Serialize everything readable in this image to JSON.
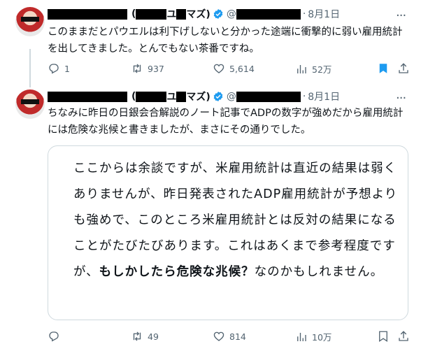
{
  "tweets": [
    {
      "name_fragment": "ユ",
      "name_open": "(",
      "name_close": "マズ)",
      "handle_prefix": "@",
      "date": "8月1日",
      "text": "このままだとパウエルは利下げしないと分かった途端に衝撃的に弱い雇用統計を出してきました。とんでもない茶番ですね。",
      "replies": "1",
      "retweets": "937",
      "likes": "5,614",
      "views": "52万"
    },
    {
      "name_fragment": "ユ",
      "name_open": "(",
      "name_close": "マズ)",
      "handle_prefix": "@",
      "date": "8月1日",
      "text": "ちなみに昨日の日銀会合解説のノート記事でADPの数字が強めだから雇用統計には危険な兆候と書きましたが、まさにその通りでした。",
      "quote": {
        "text_before": "ここからは余談ですが、米雇用統計は直近の結果は弱くありませんが、昨日発表されたADP雇用統計が予想よりも強めで、このところ米雇用統計とは反対の結果になることがたびたびあります。これはあくまで参考程度ですが、",
        "text_bold": "もしかしたら危険な兆候？",
        "text_after": "なのかもしれません。"
      },
      "replies": "",
      "retweets": "49",
      "likes": "814",
      "views": "10万"
    }
  ],
  "icons": {
    "more": "more-icon",
    "reply": "reply-icon",
    "retweet": "retweet-icon",
    "like": "heart-icon",
    "views": "views-icon",
    "bookmark": "bookmark-icon",
    "share": "share-icon"
  },
  "colors": {
    "verified": "#1d9bf0",
    "bookmark_active": "#1d9bf0",
    "muted": "#536471"
  }
}
